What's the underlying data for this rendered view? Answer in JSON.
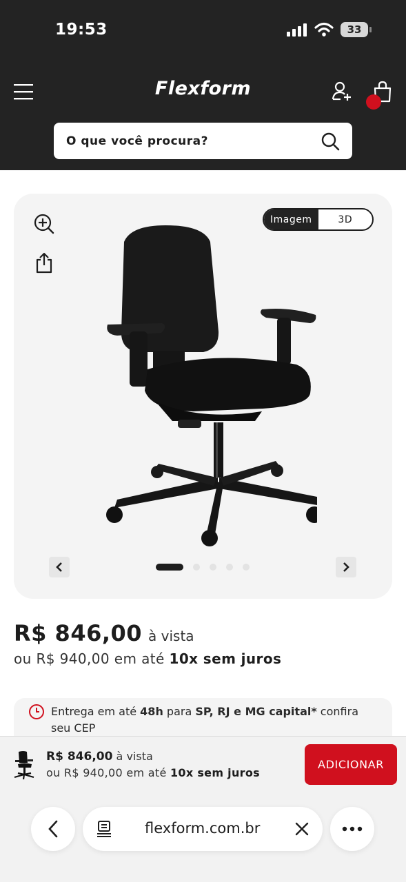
{
  "status_bar": {
    "time": "19:53",
    "battery": "33"
  },
  "header": {
    "logo": "Flexform",
    "search_placeholder": "O que você procura?"
  },
  "gallery": {
    "view_options": [
      "Imagem",
      "3D"
    ],
    "active_view": "Imagem",
    "slide_count": 5,
    "active_slide": 1
  },
  "price": {
    "cash": "R$ 846,00",
    "cash_suffix": "à vista",
    "installment_prefix": "ou R$ 940,00 em até",
    "installment_terms": "10x sem juros"
  },
  "delivery": {
    "t1": "Entrega em até ",
    "t2": "48h",
    "t3": " para ",
    "t4": "SP, RJ e MG capital*",
    "t5": " confira seu CEP"
  },
  "sticky_bar": {
    "cash": "R$ 846,00",
    "cash_suffix": "à vista",
    "installment_prefix": "ou R$ 940,00 em até",
    "installment_terms": "10x sem juros",
    "add_label": "ADICIONAR"
  },
  "browser": {
    "url": "flexform.com.br"
  },
  "colors": {
    "header_bg": "#232323",
    "accent_red": "#d0101e",
    "card_bg": "#f4f4f4"
  }
}
